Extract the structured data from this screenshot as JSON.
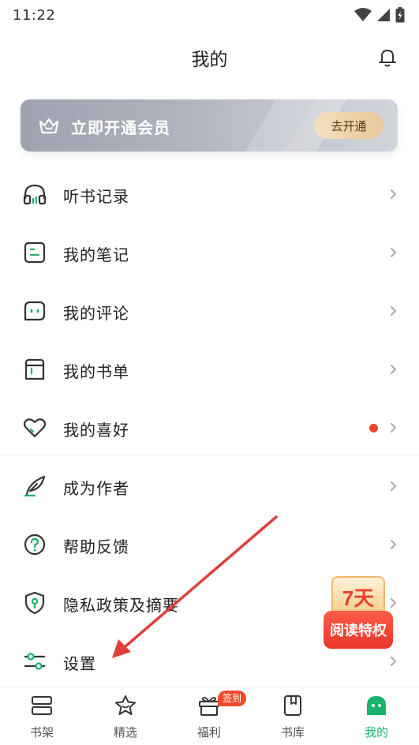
{
  "status_bar": {
    "time": "11:22"
  },
  "header": {
    "title": "我的"
  },
  "vip_banner": {
    "text": "立即开通会员",
    "button_label": "去开通"
  },
  "menu": {
    "items": [
      {
        "label": "听书记录",
        "icon": "headphones-icon"
      },
      {
        "label": "我的笔记",
        "icon": "note-icon"
      },
      {
        "label": "我的评论",
        "icon": "comment-icon"
      },
      {
        "label": "我的书单",
        "icon": "booklist-icon"
      },
      {
        "label": "我的喜好",
        "icon": "heart-icon",
        "has_dot": true
      },
      {
        "label": "成为作者",
        "icon": "feather-pen-icon"
      },
      {
        "label": "帮助反馈",
        "icon": "help-icon"
      },
      {
        "label": "隐私政策及摘要",
        "icon": "privacy-shield-icon"
      },
      {
        "label": "设置",
        "icon": "settings-sliders-icon"
      }
    ]
  },
  "promo": {
    "days": "7天",
    "text": "阅读特权"
  },
  "bottom_nav": {
    "items": [
      {
        "label": "书架",
        "icon": "bookshelf-icon"
      },
      {
        "label": "精选",
        "icon": "star-icon"
      },
      {
        "label": "福利",
        "icon": "gift-icon",
        "badge": "签到"
      },
      {
        "label": "书库",
        "icon": "book-icon"
      },
      {
        "label": "我的",
        "icon": "profile-icon",
        "active": true
      }
    ]
  },
  "colors": {
    "accent": "#19b26b",
    "badge": "#f04b2b",
    "annotation_arrow": "#e0403a"
  }
}
